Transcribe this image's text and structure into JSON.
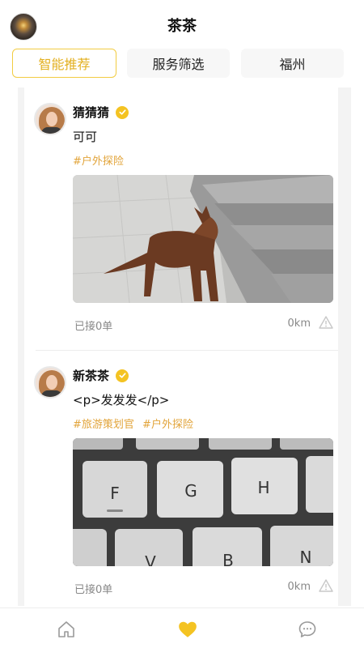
{
  "header": {
    "title": "茶茶",
    "avatar_icon": "user-avatar-icon"
  },
  "tabs": [
    {
      "label": "智能推荐",
      "active": true
    },
    {
      "label": "服务筛选",
      "active": false
    },
    {
      "label": "福州",
      "active": false
    }
  ],
  "posts": [
    {
      "name": "猜猜猜",
      "content": "可可",
      "tags": [
        "#户外探险"
      ],
      "image": "brown-dog-photo",
      "orders": "已接0单",
      "distance": "0km"
    },
    {
      "name": "新茶茶",
      "content": "<p>发发发</p>",
      "tags": [
        "#旅游策划官",
        "#户外探险"
      ],
      "image": "keyboard-photo",
      "orders": "已接0单",
      "distance": "0km"
    }
  ],
  "bottom_nav": [
    {
      "icon": "home-icon",
      "active": false
    },
    {
      "icon": "heart-icon",
      "active": true
    },
    {
      "icon": "chat-icon",
      "active": false
    }
  ],
  "colors": {
    "accent": "#f4c322",
    "tag": "#e2a43a",
    "muted": "#888888"
  }
}
